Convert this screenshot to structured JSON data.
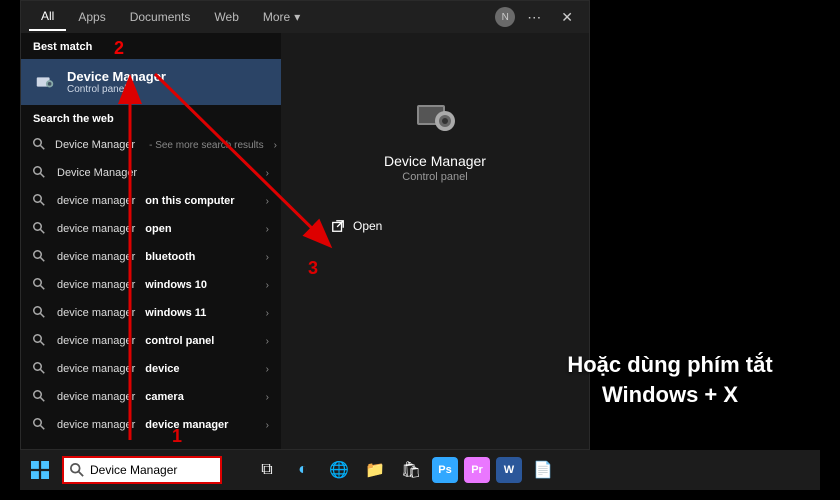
{
  "tabs": {
    "all": "All",
    "apps": "Apps",
    "documents": "Documents",
    "web": "Web",
    "more": "More"
  },
  "avatar_initial": "N",
  "sections": {
    "best_match": "Best match",
    "search_web": "Search the web"
  },
  "best_match_item": {
    "title": "Device Manager",
    "subtitle": "Control panel"
  },
  "web_results": [
    {
      "text": "Device Manager",
      "hint": "See more search results",
      "strong": ""
    },
    {
      "text": "Device Manager",
      "hint": "",
      "strong": ""
    },
    {
      "text": "device manager ",
      "hint": "",
      "strong": "on this computer"
    },
    {
      "text": "device manager ",
      "hint": "",
      "strong": "open"
    },
    {
      "text": "device manager ",
      "hint": "",
      "strong": "bluetooth"
    },
    {
      "text": "device manager ",
      "hint": "",
      "strong": "windows 10"
    },
    {
      "text": "device manager ",
      "hint": "",
      "strong": "windows 11"
    },
    {
      "text": "device manager ",
      "hint": "",
      "strong": "control panel"
    },
    {
      "text": "device manager ",
      "hint": "",
      "strong": "device"
    },
    {
      "text": "device manager ",
      "hint": "",
      "strong": "camera"
    },
    {
      "text": "device manager ",
      "hint": "",
      "strong": "device manager"
    }
  ],
  "detail": {
    "title": "Device Manager",
    "subtitle": "Control panel",
    "open": "Open"
  },
  "search_value": "Device Manager",
  "overlay": "Hoặc dùng phím tắt Windows + X",
  "callouts": {
    "one": "1",
    "two": "2",
    "three": "3"
  },
  "taskbar_apps": [
    {
      "name": "task-view",
      "color": "#fff",
      "glyph": "⧉"
    },
    {
      "name": "cortana",
      "color": "#4cc2ff",
      "glyph": "◐"
    },
    {
      "name": "edge",
      "color": "#35c1d4",
      "glyph": "🌐"
    },
    {
      "name": "explorer",
      "color": "#f6c76b",
      "glyph": "📁"
    },
    {
      "name": "store",
      "color": "#fff",
      "glyph": "🛍"
    },
    {
      "name": "photoshop",
      "color": "#31a8ff",
      "glyph": "Ps"
    },
    {
      "name": "premiere",
      "color": "#ea77ff",
      "glyph": "Pr"
    },
    {
      "name": "word",
      "color": "#2b579a",
      "glyph": "W"
    },
    {
      "name": "file",
      "color": "#bbb",
      "glyph": "📄"
    }
  ]
}
